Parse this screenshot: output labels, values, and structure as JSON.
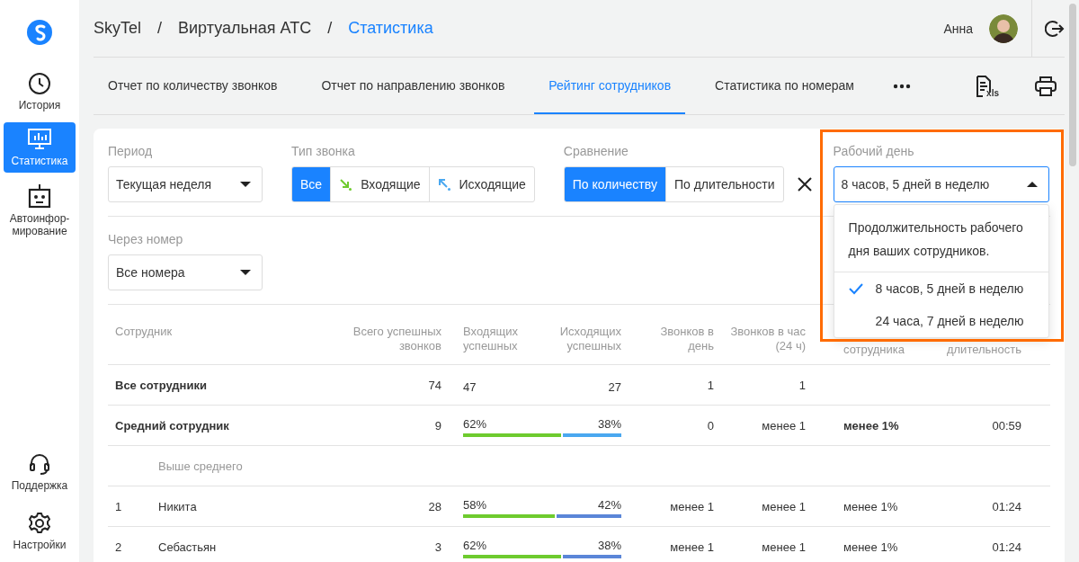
{
  "sidebar": {
    "items": [
      {
        "label": "История",
        "selected": false
      },
      {
        "label": "Статистика",
        "selected": true
      },
      {
        "label": "Автоинфор-мирование",
        "selected": false
      }
    ],
    "bottom_items": [
      {
        "label": "Поддержка",
        "selected": false
      },
      {
        "label": "Настройки",
        "selected": false
      }
    ]
  },
  "breadcrumbs": [
    {
      "label": "SkyTel",
      "current": false
    },
    {
      "label": "Виртуальная АТС",
      "current": false
    },
    {
      "label": "Статистика",
      "current": true
    }
  ],
  "breadcrumb_separator": "/",
  "user": {
    "name": "Анна"
  },
  "tabs": [
    {
      "label": "Отчет по количеству звонков",
      "selected": false
    },
    {
      "label": "Отчет по направлению звонков",
      "selected": false
    },
    {
      "label": "Рейтинг сотрудников",
      "selected": true
    },
    {
      "label": "Статистика по номерам",
      "selected": false
    }
  ],
  "export_label": "xls",
  "filters": {
    "period": {
      "label": "Период",
      "value": "Текущая неделя"
    },
    "call_type": {
      "label": "Тип звонка",
      "options": [
        {
          "label": "Все",
          "selected": true
        },
        {
          "label": "Входящие",
          "selected": false
        },
        {
          "label": "Исходящие",
          "selected": false
        }
      ]
    },
    "comparison": {
      "label": "Сравнение",
      "options": [
        {
          "label": "По количеству",
          "selected": true
        },
        {
          "label": "По длительности",
          "selected": false
        }
      ]
    },
    "workday": {
      "label": "Рабочий день",
      "value": "8 часов, 5 дней в неделю",
      "expanded": true,
      "highlighted": true,
      "hint": "Продолжительность рабочего дня ваших сотрудников.",
      "options": [
        {
          "label": "8 часов, 5 дней в неделю",
          "selected": true
        },
        {
          "label": "24 часа, 7 дней в неделю",
          "selected": false
        }
      ]
    },
    "via_number": {
      "label": "Через номер",
      "value": "Все номера"
    }
  },
  "table": {
    "columns": [
      "Сотрудник",
      "Всего успешных звонков",
      "Входящих успешных",
      "Исходящих успешных",
      "Звонков в день",
      "Звонков в час (24 ч)",
      "сотрудника",
      "длительность"
    ],
    "rows": [
      {
        "kind": "total",
        "name": "Все сотрудники",
        "total": "74",
        "incoming": "47",
        "outgoing": "27",
        "per_day": "1",
        "per_hour": "1"
      },
      {
        "kind": "average",
        "name": "Средний сотрудник",
        "total": "9",
        "incoming": "62%",
        "outgoing": "38%",
        "level": 0.62,
        "per_day": "0",
        "per_hour": "менее 1",
        "share": "менее 1%",
        "duration": "00:59"
      },
      {
        "kind": "group",
        "name": "Выше среднего"
      },
      {
        "kind": "employee",
        "number": "1",
        "name": "Никита",
        "total": "28",
        "incoming": "58%",
        "outgoing": "42%",
        "level": 0.58,
        "per_day": "менее 1",
        "per_hour": "менее 1",
        "share": "менее 1%",
        "duration": "01:24"
      },
      {
        "kind": "employee",
        "number": "2",
        "name": "Себастьян",
        "total": "3",
        "incoming": "62%",
        "outgoing": "38%",
        "level": 0.62,
        "per_day": "менее 1",
        "per_hour": "менее 1",
        "share": "менее 1%",
        "duration": "01:24"
      }
    ]
  }
}
